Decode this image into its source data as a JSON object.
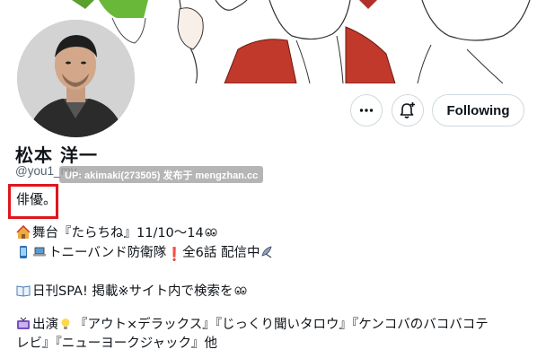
{
  "profile": {
    "display_name": "松本 洋一",
    "handle": "@you1_my",
    "watermark": "UP: akimaki(273505) 发布于 mengzhan.cc",
    "occupation": "俳優。"
  },
  "actions": {
    "more_icon": "more-horizontal-icon",
    "notify_icon": "bell-plus-icon",
    "follow_label": "Following"
  },
  "bio": {
    "stage": "舞台『たらちね』11/10～14",
    "series": "トニーバンド防衛隊",
    "series_info": "全6話 配信中",
    "magazine": "日刊SPA! 掲載※サイト内で検索を",
    "appearance_1": "出演",
    "appearance_2": "『アウト×デラックス』『じっくり聞いタロウ』『ケンコバのバコバコテ",
    "appearance_3": "レビ』『ニューヨークジャック』他"
  },
  "colors": {
    "highlight": "#e0161c",
    "border": "#cfd9de",
    "secondary_text": "#536471"
  }
}
